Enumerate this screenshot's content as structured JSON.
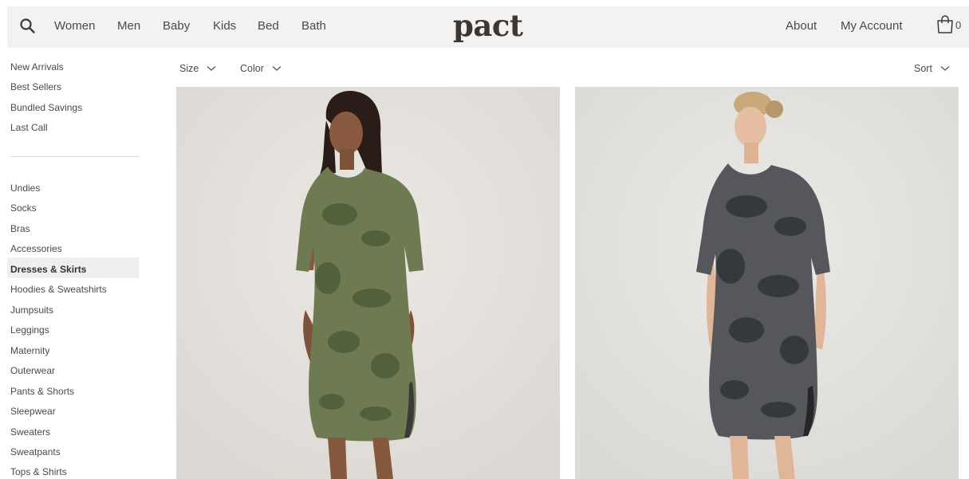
{
  "brand": {
    "logo": "pact"
  },
  "header": {
    "search_icon": "search-icon",
    "nav_left": [
      "Women",
      "Men",
      "Baby",
      "Kids",
      "Bed",
      "Bath"
    ],
    "nav_right": [
      "About",
      "My Account"
    ],
    "cart_icon": "shopping-bag-icon",
    "cart_count": "0"
  },
  "sidebar": {
    "top_items": [
      "New Arrivals",
      "Best Sellers",
      "Bundled Savings",
      "Last Call"
    ],
    "categories": [
      "Undies",
      "Socks",
      "Bras",
      "Accessories",
      "Dresses & Skirts",
      "Hoodies & Sweatshirts",
      "Jumpsuits",
      "Leggings",
      "Maternity",
      "Outerwear",
      "Pants & Shorts",
      "Sleepwear",
      "Sweaters",
      "Sweatpants",
      "Tops & Shirts"
    ],
    "active_category": "Dresses & Skirts"
  },
  "filters": {
    "size_label": "Size",
    "color_label": "Color",
    "sort_label": "Sort"
  },
  "products": [
    {
      "image": "woman-in-olive-tie-dye-midi-dress",
      "color": "#6e7a52"
    },
    {
      "image": "woman-in-charcoal-tie-dye-midi-dress",
      "color": "#4a4c52"
    }
  ],
  "colors": {
    "header_bg": "#f3f2f0",
    "text": "#4a4a4a",
    "active_bg": "#efefef"
  }
}
